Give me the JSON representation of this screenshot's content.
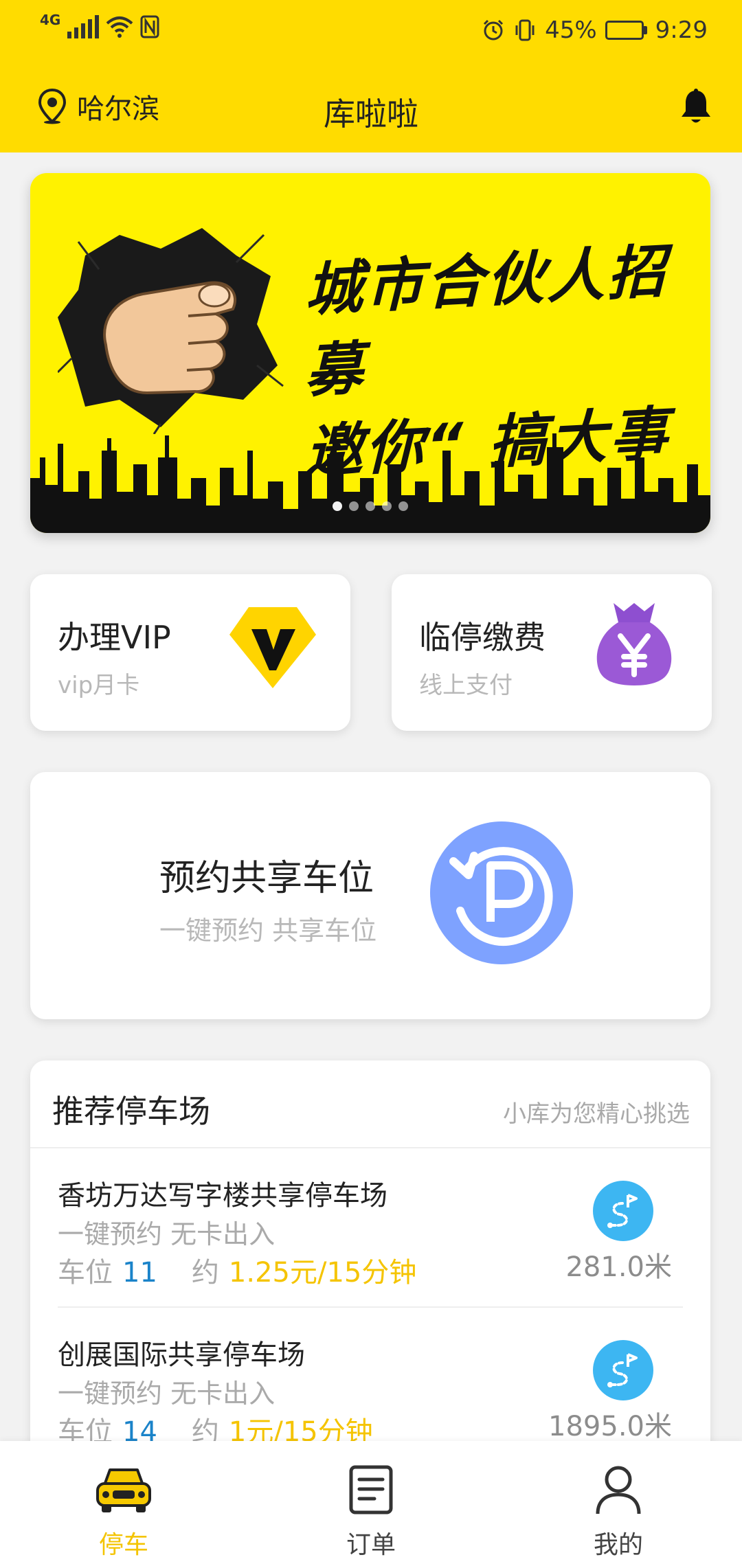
{
  "status_bar": {
    "network": "4G",
    "battery": "45%",
    "battery_level": 0.45,
    "time": "9:29"
  },
  "header": {
    "city": "哈尔滨",
    "title": "库啦啦",
    "accent": "#ffdc00"
  },
  "banner": {
    "line1": "城市合伙人招募",
    "line2": "邀你“ 搞大事 ”",
    "slide_count": 5,
    "active_slide": 1
  },
  "services": {
    "vip": {
      "title": "办理VIP",
      "subtitle": "vip月卡",
      "icon": "vip-diamond-icon"
    },
    "pay": {
      "title": "临停缴费",
      "subtitle": "线上支付",
      "icon": "money-bag-icon"
    },
    "reserve": {
      "title": "预约共享车位",
      "subtitle": "一键预约 共享车位",
      "icon": "parking-refresh-icon"
    }
  },
  "recommended": {
    "title": "推荐停车场",
    "hint": "小库为您精心挑选",
    "lots": [
      {
        "name": "香坊万达写字楼共享停车场",
        "desc": "一键预约 无卡出入",
        "slots_label": "车位",
        "slots": "11",
        "price_prefix": "约",
        "price": "1.25元/15分钟",
        "distance": "281.0米"
      },
      {
        "name": "创展国际共享停车场",
        "desc": "一键预约 无卡出入",
        "slots_label": "车位",
        "slots": "14",
        "price_prefix": "约",
        "price": "1元/15分钟",
        "distance": "1895.0米"
      }
    ]
  },
  "tabs": [
    {
      "label": "停车",
      "icon": "car-icon",
      "active": true
    },
    {
      "label": "订单",
      "icon": "document-icon",
      "active": false
    },
    {
      "label": "我的",
      "icon": "user-icon",
      "active": false
    }
  ],
  "colors": {
    "active_tab": "#f4c400",
    "slot_count": "#1a83c9",
    "price": "#f5c400",
    "reserve_icon": "#7ea2ff",
    "nav_icon": "#3db6f2",
    "money_bag": "#9b59d6"
  }
}
